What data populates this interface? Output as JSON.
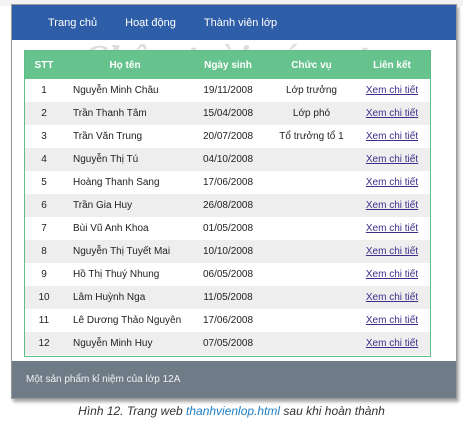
{
  "nav": {
    "items": [
      "Trang chủ",
      "Hoạt động",
      "Thành viên lớp"
    ]
  },
  "watermark": "Chân trời sáng tạo",
  "table": {
    "headers": [
      "STT",
      "Họ tên",
      "Ngày sinh",
      "Chức vụ",
      "Liên kết"
    ],
    "rows": [
      {
        "stt": "1",
        "name": "Nguyễn Minh Châu",
        "dob": "19/11/2008",
        "role": "Lớp trưởng",
        "link": "Xem chi tiết"
      },
      {
        "stt": "2",
        "name": "Trần Thanh Tâm",
        "dob": "15/04/2008",
        "role": "Lớp phó",
        "link": "Xem chi tiết"
      },
      {
        "stt": "3",
        "name": "Trần Văn Trung",
        "dob": "20/07/2008",
        "role": "Tổ trưởng tổ 1",
        "link": "Xem chi tiết"
      },
      {
        "stt": "4",
        "name": "Nguyễn Thị Tú",
        "dob": "04/10/2008",
        "role": "",
        "link": "Xem chi tiết"
      },
      {
        "stt": "5",
        "name": "Hoàng Thanh Sang",
        "dob": "17/06/2008",
        "role": "",
        "link": "Xem chi tiết"
      },
      {
        "stt": "6",
        "name": "Trần Gia Huy",
        "dob": "26/08/2008",
        "role": "",
        "link": "Xem chi tiết"
      },
      {
        "stt": "7",
        "name": "Bùi Vũ Anh Khoa",
        "dob": "01/05/2008",
        "role": "",
        "link": "Xem chi tiết"
      },
      {
        "stt": "8",
        "name": "Nguyễn Thị Tuyết Mai",
        "dob": "10/10/2008",
        "role": "",
        "link": "Xem chi tiết"
      },
      {
        "stt": "9",
        "name": "Hồ Thị Thuý Nhung",
        "dob": "06/05/2008",
        "role": "",
        "link": "Xem chi tiết"
      },
      {
        "stt": "10",
        "name": "Lâm Huỳnh Nga",
        "dob": "11/05/2008",
        "role": "",
        "link": "Xem chi tiết"
      },
      {
        "stt": "11",
        "name": "Lê Dương Thảo Nguyên",
        "dob": "17/06/2008",
        "role": "",
        "link": "Xem chi tiết"
      },
      {
        "stt": "12",
        "name": "Nguyễn Minh Huy",
        "dob": "07/05/2008",
        "role": "",
        "link": "Xem chi tiết"
      }
    ]
  },
  "footer": {
    "text": "Một sản phẩm kỉ niệm của lớp 12A"
  },
  "caption": {
    "prefix": "Hình 12. Trang web ",
    "filename": "thanhvienlop.html",
    "suffix": " sau khi hoàn thành"
  },
  "colors": {
    "navbar": "#2f5ea9",
    "table_header": "#66c38e",
    "footer": "#6f7c88",
    "link": "#3a2f8a",
    "caption_filename": "#1e7fc6"
  }
}
